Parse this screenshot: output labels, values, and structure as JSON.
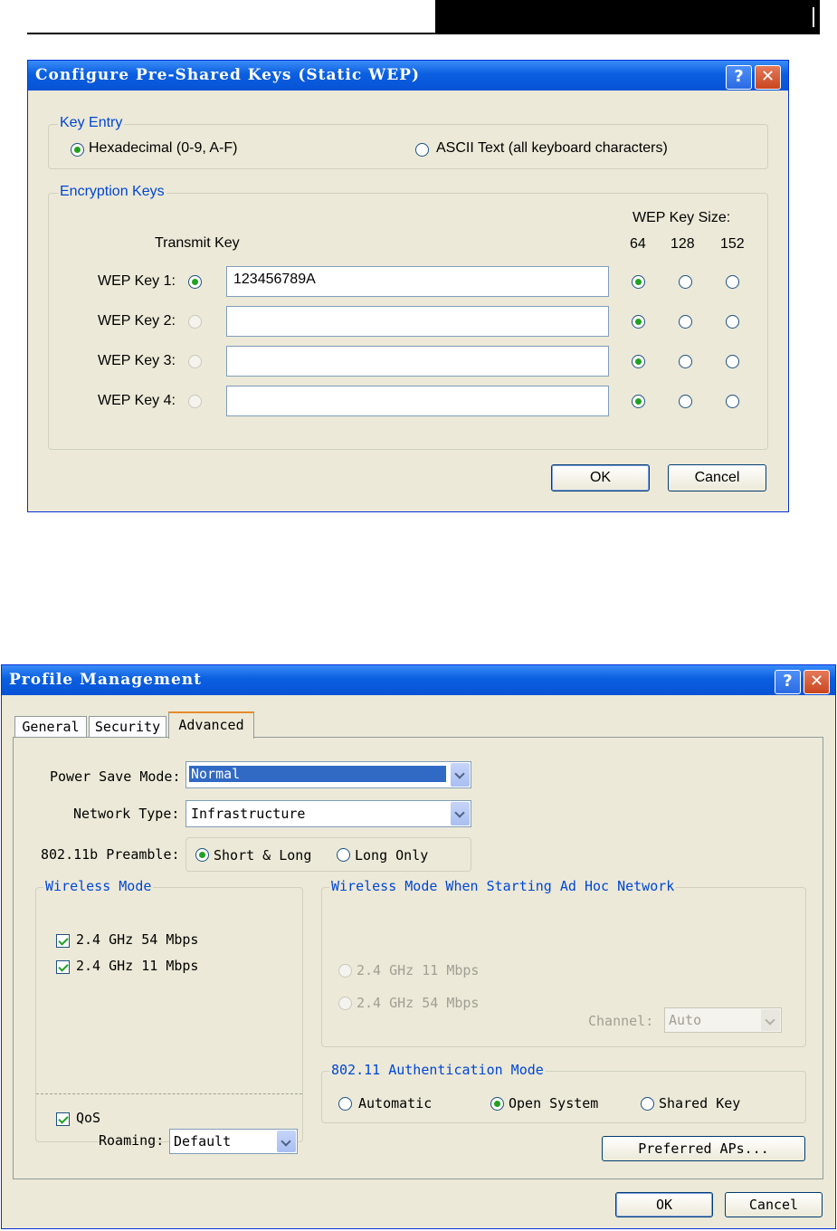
{
  "dialog1": {
    "title": "Configure Pre-Shared Keys (Static WEP)",
    "help_label": "?",
    "close_label": "✕",
    "key_entry": {
      "legend": "Key Entry",
      "hex_label": "Hexadecimal (0-9, A-F)",
      "ascii_label": "ASCII Text (all keyboard characters)",
      "selected": "hex"
    },
    "encryption": {
      "legend": "Encryption Keys",
      "transmit_header": "Transmit Key",
      "size_header": "WEP Key Size:",
      "sizes": [
        "64",
        "128",
        "152"
      ],
      "keys": [
        {
          "label": "WEP Key 1:",
          "value": "123456789A",
          "transmit": true,
          "size": "64"
        },
        {
          "label": "WEP Key 2:",
          "value": "",
          "transmit": false,
          "size": "64"
        },
        {
          "label": "WEP Key 3:",
          "value": "",
          "transmit": false,
          "size": "64"
        },
        {
          "label": "WEP Key 4:",
          "value": "",
          "transmit": false,
          "size": "64"
        }
      ]
    },
    "ok_label": "OK",
    "cancel_label": "Cancel"
  },
  "dialog2": {
    "title": "Profile Management",
    "help_label": "?",
    "close_label": "✕",
    "tabs": [
      "General",
      "Security",
      "Advanced"
    ],
    "active_tab": "Advanced",
    "power_save": {
      "label": "Power Save Mode:",
      "value": "Normal"
    },
    "network_type": {
      "label": "Network Type:",
      "value": "Infrastructure"
    },
    "preamble": {
      "label": "802.11b Preamble:",
      "short_long": "Short & Long",
      "long_only": "Long Only",
      "selected": "short_long"
    },
    "wireless_mode": {
      "legend": "Wireless Mode",
      "opt1": "2.4 GHz 54 Mbps",
      "opt2": "2.4 GHz 11 Mbps",
      "qos": "QoS"
    },
    "adhoc": {
      "legend": "Wireless Mode When Starting Ad Hoc Network",
      "opt1": "2.4 GHz 11 Mbps",
      "opt2": "2.4 GHz 54 Mbps",
      "channel_label": "Channel:",
      "channel_value": "Auto"
    },
    "auth": {
      "legend": "802.11 Authentication Mode",
      "automatic": "Automatic",
      "open": "Open System",
      "shared": "Shared Key",
      "selected": "open"
    },
    "roaming": {
      "label": "Roaming:",
      "value": "Default"
    },
    "preferred_label": "Preferred APs...",
    "ok_label": "OK",
    "cancel_label": "Cancel"
  }
}
